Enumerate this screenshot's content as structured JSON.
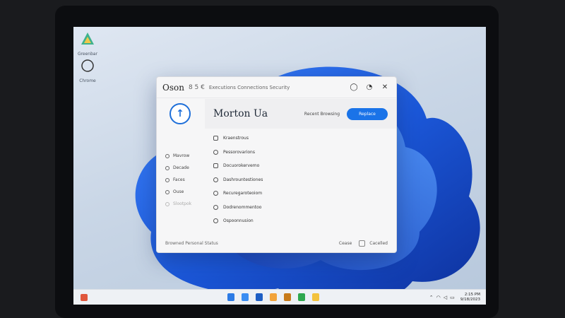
{
  "desktop": {
    "icons": [
      {
        "label": "Greenbar"
      },
      {
        "label": "Chrome"
      }
    ]
  },
  "window": {
    "title": "Oson",
    "title_glyphs": "8 5 €",
    "breadcrumb": "Executions Connections Security",
    "sidebar": {
      "items": [
        {
          "label": "Mavrow"
        },
        {
          "label": "Decade"
        },
        {
          "label": "Faces"
        },
        {
          "label": "Ouse"
        },
        {
          "label": "Slootpok"
        }
      ]
    },
    "main": {
      "title": "Morton Ua",
      "header_link": "Recent Browsing",
      "primary_button": "Replace",
      "rows": [
        {
          "label": "Kraenstrous"
        },
        {
          "label": "Pessorovarions"
        },
        {
          "label": "Docuorokervemo"
        },
        {
          "label": "Dashrountestiones"
        },
        {
          "label": "Recuregaroteoiom"
        },
        {
          "label": "Dodrenommentoo"
        },
        {
          "label": "Ospoonnusion"
        }
      ]
    },
    "footer": {
      "left": "Browned Personal Status",
      "link": "Cease",
      "right": "Cacelled"
    }
  },
  "taskbar": {
    "clock_time": "2:15 PM",
    "clock_date": "9/18/2023"
  },
  "colors": {
    "accent": "#1a73e8",
    "logo": "#1e6fd9",
    "bloom": "#1d5fe0"
  }
}
